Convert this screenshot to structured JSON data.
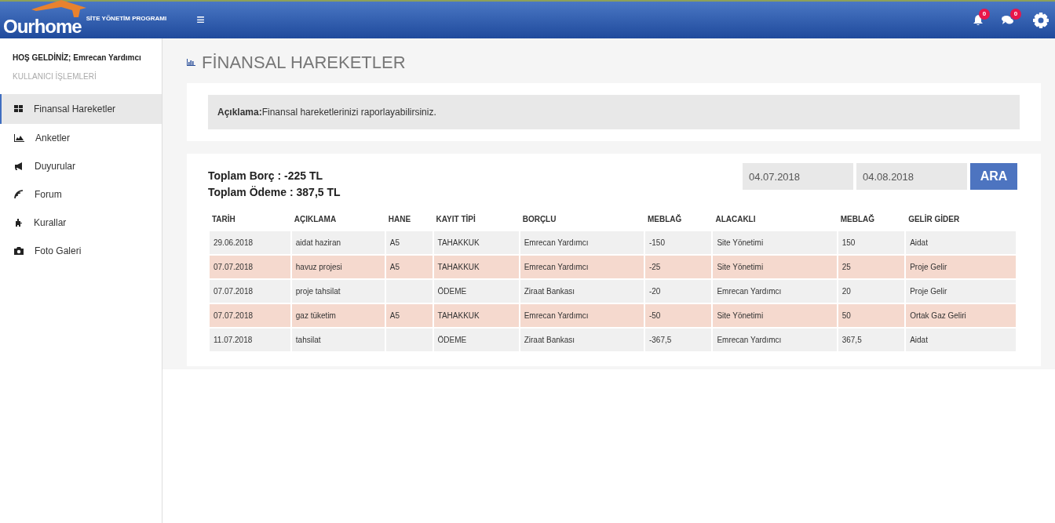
{
  "header": {
    "logo": "Ourhome",
    "subtitle": "SİTE YÖNETİM PROGRAMI",
    "menu_glyph": "≡",
    "notifications": "0",
    "messages": "0"
  },
  "sidebar": {
    "welcome": "HOŞ GELDİNİZ; Emrecan Yardımcı",
    "section": "KULLANICI İŞLEMLERİ",
    "items": [
      {
        "label": "Finansal Hareketler",
        "selected": true
      },
      {
        "label": "Anketler",
        "selected": false
      },
      {
        "label": "Duyurular",
        "selected": false
      },
      {
        "label": "Forum",
        "selected": false
      },
      {
        "label": "Kurallar",
        "selected": false
      },
      {
        "label": "Foto Galeri",
        "selected": false
      }
    ]
  },
  "page": {
    "title": "FİNANSAL HAREKETLER",
    "description": "**Açıklama:**Finansal hareketlerinizi raporlayabilirsiniz."
  },
  "summary": {
    "total_debt": "Toplam Borç : -225 TL",
    "total_payment": "Toplam Ödeme : 387,5 TL"
  },
  "filter": {
    "start_date": "04.07.2018",
    "end_date": "04.08.2018",
    "button": "ARA"
  },
  "table": {
    "columns": [
      "TARİH",
      "AÇIKLAMA",
      "HANE",
      "KAYIT TİPİ",
      "BORÇLU",
      "MEBLAĞ",
      "ALACAKLI",
      "MEBLAĞ",
      "GELİR GİDER"
    ],
    "rows": [
      [
        "29.06.2018",
        "aidat haziran",
        "A5",
        "TAHAKKUK",
        "Emrecan Yardımcı",
        "-150",
        "Site Yönetimi",
        "150",
        "Aidat"
      ],
      [
        "07.07.2018",
        "havuz projesi",
        "A5",
        "TAHAKKUK",
        "Emrecan Yardımcı",
        "-25",
        "Site Yönetimi",
        "25",
        "Proje Gelir"
      ],
      [
        "07.07.2018",
        "proje tahsilat",
        "",
        "ÖDEME",
        "Ziraat Bankası",
        "-20",
        "Emrecan Yardımcı",
        "20",
        "Proje Gelir"
      ],
      [
        "07.07.2018",
        "gaz tüketim",
        "A5",
        "TAHAKKUK",
        "Emrecan Yardımcı",
        "-50",
        "Site Yönetimi",
        "50",
        "Ortak Gaz Geliri"
      ],
      [
        "11.07.2018",
        "tahsilat",
        "",
        "ÖDEME",
        "Ziraat Bankası",
        "-367,5",
        "Emrecan Yardımcı",
        "367,5",
        "Aidat"
      ]
    ]
  }
}
